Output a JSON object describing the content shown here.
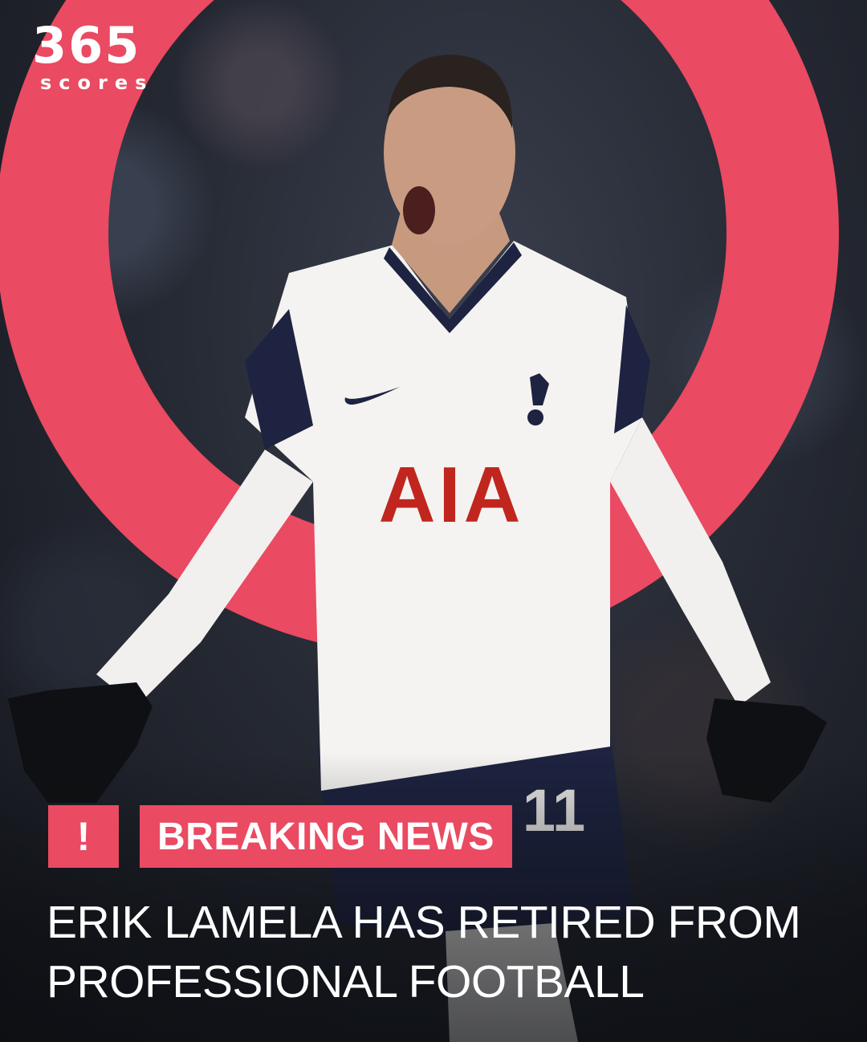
{
  "brand": {
    "logo_number": "365",
    "logo_word": "scores",
    "accent_color": "#ea4a62"
  },
  "photo": {
    "icon": "footballer-celebrating-photo",
    "shirt_sponsor": "AIA",
    "shirt_number": "11"
  },
  "badge": {
    "alert_symbol": "!",
    "label": "BREAKING NEWS"
  },
  "headline": {
    "line1": "ERIK LAMELA HAS RETIRED FROM",
    "line2": "PROFESSIONAL FOOTBALL"
  }
}
